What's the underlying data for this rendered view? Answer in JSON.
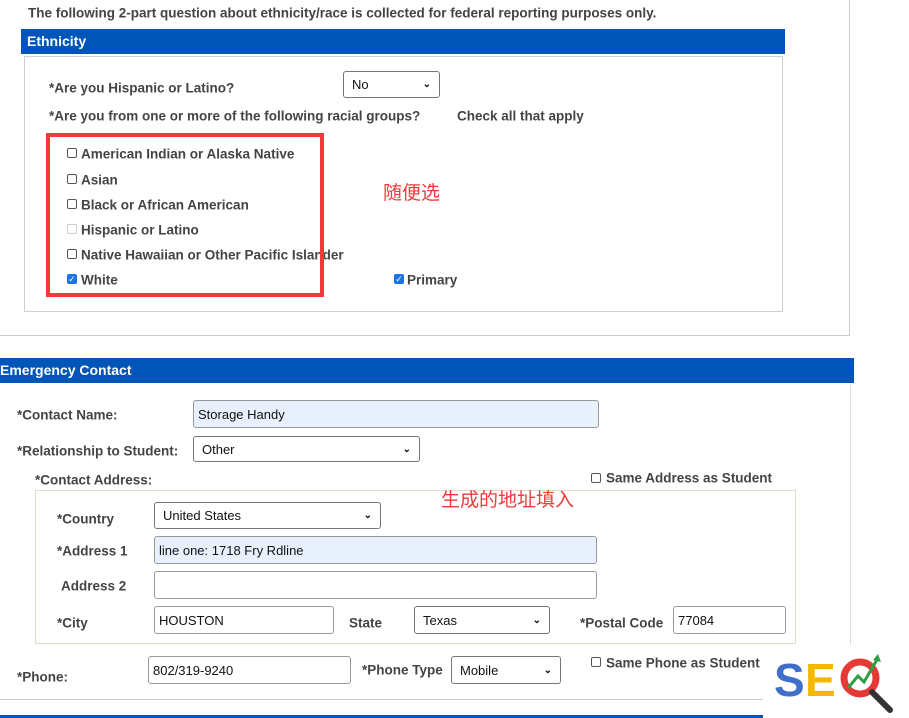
{
  "intro_text": "The following 2-part question about ethnicity/race is collected for federal reporting purposes only.",
  "ethnicity": {
    "header": "Ethnicity",
    "hispanic_question": "*Are you Hispanic or Latino?",
    "hispanic_value": "No",
    "racial_question": "*Are you from one or more of the following racial groups?",
    "check_all": "Check all that apply",
    "options": [
      {
        "label": "American Indian or Alaska Native",
        "checked": false
      },
      {
        "label": "Asian",
        "checked": false
      },
      {
        "label": "Black or African American",
        "checked": false
      },
      {
        "label": "Hispanic or Latino",
        "checked": false,
        "disabled": true
      },
      {
        "label": "Native Hawaiian or Other Pacific Islander",
        "checked": false
      },
      {
        "label": "White",
        "checked": true
      }
    ],
    "primary_label": "Primary",
    "annotation": "随便选"
  },
  "emergency": {
    "header": "Emergency Contact",
    "contact_name_label": "*Contact Name:",
    "contact_name_value": "Storage Handy",
    "relationship_label": "*Relationship to Student:",
    "relationship_value": "Other",
    "address_label": "*Contact Address:",
    "same_address_label": "Same Address as Student",
    "annotation": "生成的地址填入",
    "country_label": "*Country",
    "country_value": "United States",
    "address1_label": "*Address 1",
    "address1_value": "line one: 1718 Fry Rdline",
    "address2_label": "Address 2",
    "address2_value": "",
    "city_label": "*City",
    "city_value": "HOUSTON",
    "state_label": "State",
    "state_value": "Texas",
    "postal_label": "*Postal Code",
    "postal_value": "77084",
    "phone_label": "*Phone:",
    "phone_value": "802/319-9240",
    "phone_type_label": "*Phone Type",
    "phone_type_value": "Mobile",
    "same_phone_label": "Same Phone as Student"
  },
  "watermark": {
    "text": "SEO",
    "colors": [
      "#3f6fc9",
      "#f5b800",
      "#e53935",
      "#2e9e44"
    ]
  },
  "colors": {
    "header_blue": "#0056b8",
    "annotation_red": "#f03a3a",
    "filled_input": "#e8f0fe"
  }
}
